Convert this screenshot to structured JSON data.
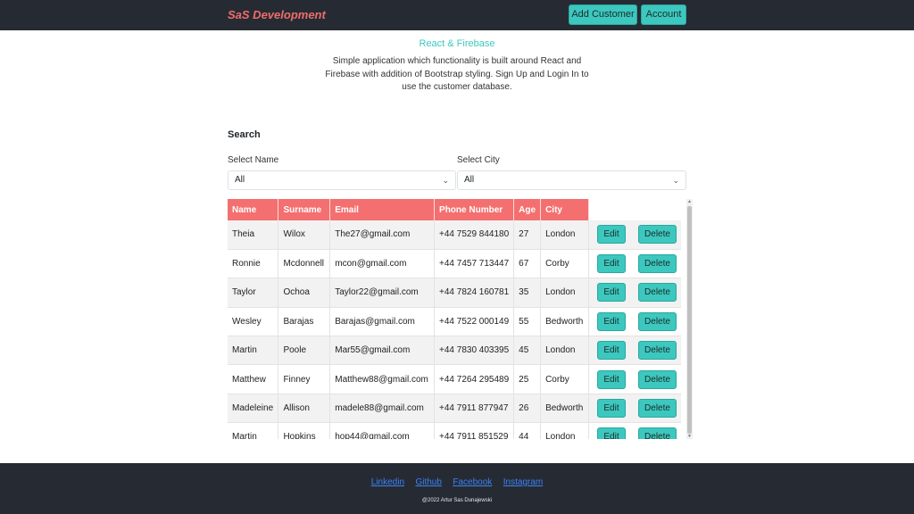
{
  "navbar": {
    "brand": "SaS Development",
    "add_customer": "Add Customer",
    "account": "Account"
  },
  "hero": {
    "title": "React & Firebase",
    "text": "Simple application which functionality is built around React and Firebase with addition of Bootstrap styling. Sign Up and Login In to use the customer database."
  },
  "search": {
    "title": "Search",
    "name_label": "Select Name",
    "name_value": "All",
    "city_label": "Select City",
    "city_value": "All"
  },
  "table": {
    "headers": [
      "Name",
      "Surname",
      "Email",
      "Phone Number",
      "Age",
      "City"
    ],
    "edit_label": "Edit",
    "delete_label": "Delete",
    "rows": [
      [
        "Theia",
        "Wilox",
        "The27@gmail.com",
        "+44 7529 844180",
        "27",
        "London"
      ],
      [
        "Ronnie",
        "Mcdonnell",
        "mcon@gmail.com",
        "+44 7457 713447",
        "67",
        "Corby"
      ],
      [
        "Taylor",
        "Ochoa",
        "Taylor22@gmail.com",
        "+44 7824 160781",
        "35",
        "London"
      ],
      [
        "Wesley",
        "Barajas",
        "Barajas@gmail.com",
        "+44 7522 000149",
        "55",
        "Bedworth"
      ],
      [
        "Martin",
        "Poole",
        "Mar55@gmail.com",
        "+44 7830 403395",
        "45",
        "London"
      ],
      [
        "Matthew",
        "Finney",
        "Matthew88@gmail.com",
        "+44 7264 295489",
        "25",
        "Corby"
      ],
      [
        "Madeleine",
        "Allison",
        "madele88@gmail.com",
        "+44 7911 877947",
        "26",
        "Bedworth"
      ],
      [
        "Martin",
        "Hopkins",
        "hop44@gmail.com",
        "+44 7911 851529",
        "44",
        "London"
      ]
    ]
  },
  "footer": {
    "links": [
      "Linkedin",
      "Github",
      "Facebook",
      "Instagram"
    ],
    "copyright": "@2022 Artur Sas Dunajewski"
  },
  "colors": {
    "nav_bg": "#262b33",
    "brand": "#f06c6c",
    "accent": "#3cc8be",
    "table_header": "#f46f6f",
    "link": "#3b82f6"
  },
  "icons": {
    "select_chevron": "chevron-down-icon",
    "scroll_up": "scroll-up-arrow-icon",
    "scroll_down": "scroll-down-arrow-icon"
  }
}
